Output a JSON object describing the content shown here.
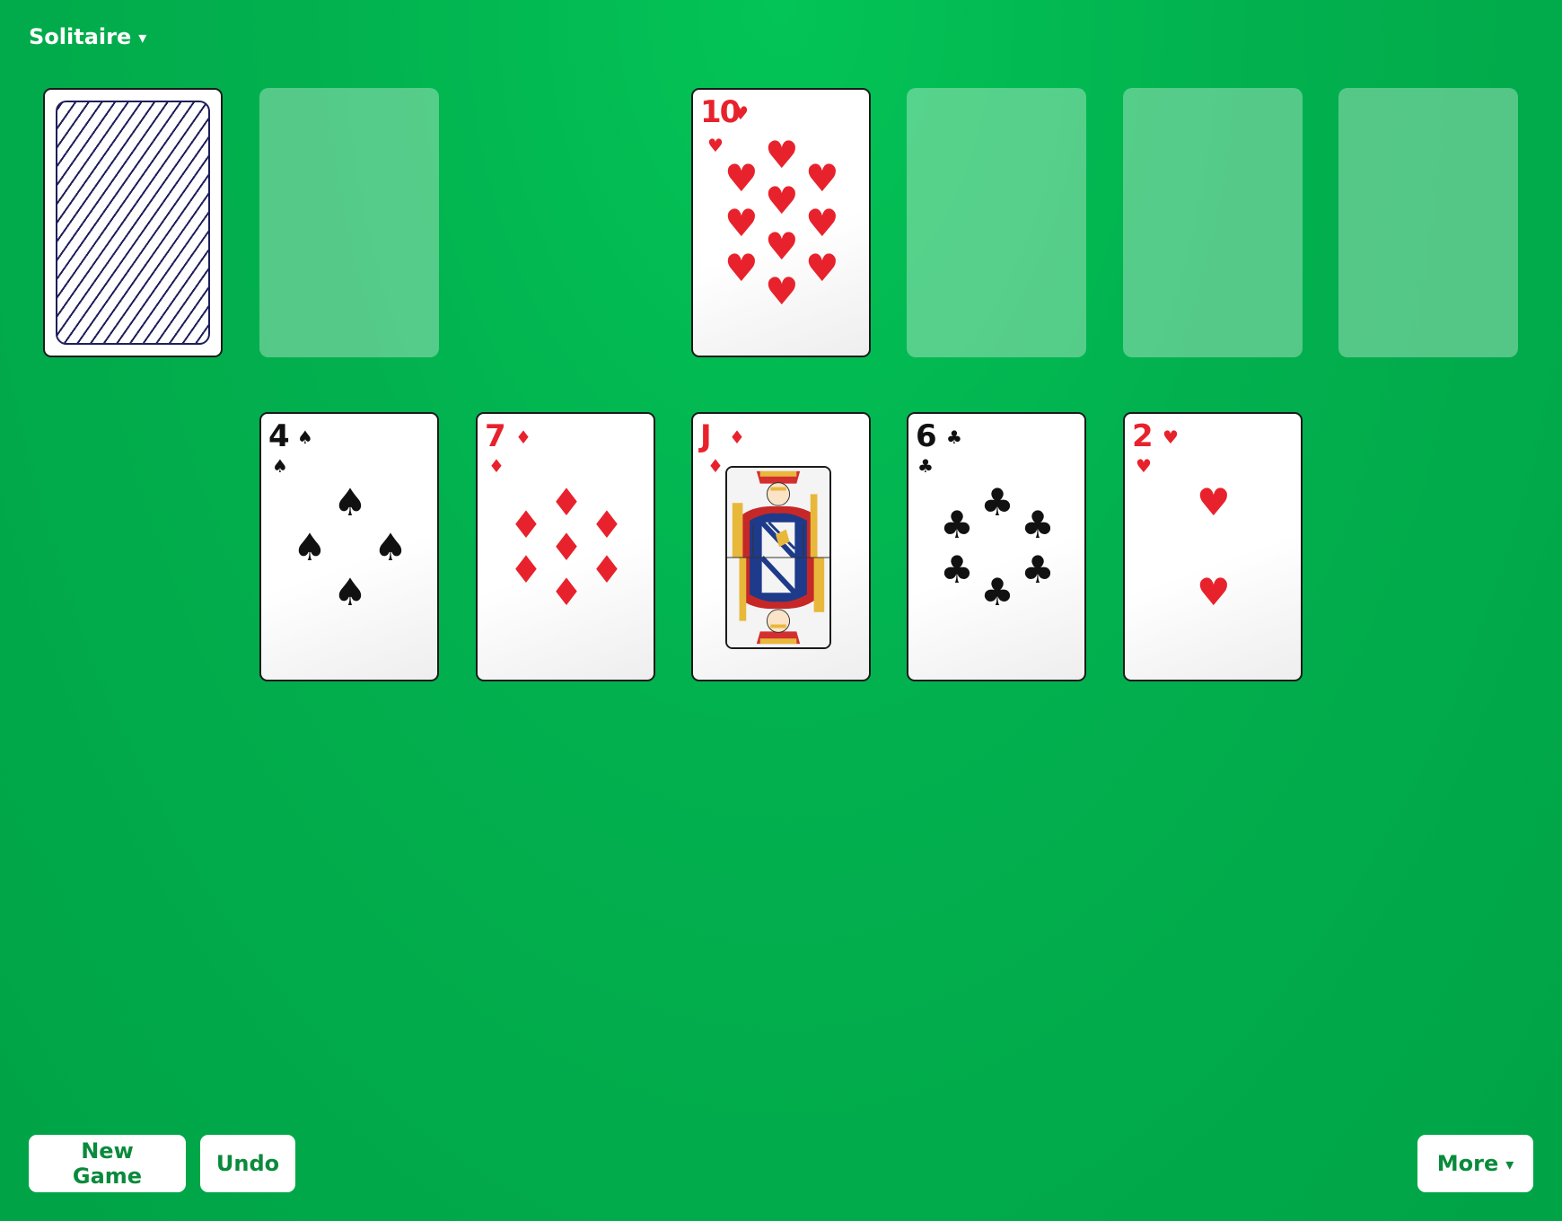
{
  "header": {
    "title": "Solitaire",
    "caret": "▾"
  },
  "stock": {
    "face_down": true
  },
  "foundation_top": {
    "rank": "10",
    "suit": "♥",
    "color": "red"
  },
  "tableau": [
    {
      "rank": "4",
      "suit": "♠",
      "color": "black"
    },
    {
      "rank": "7",
      "suit": "♦",
      "color": "red"
    },
    {
      "rank": "J",
      "suit": "♦",
      "color": "red"
    },
    {
      "rank": "6",
      "suit": "♣",
      "color": "black"
    },
    {
      "rank": "2",
      "suit": "♥",
      "color": "red"
    }
  ],
  "toolbar": {
    "new_game_label": "New Game",
    "undo_label": "Undo",
    "more_label": "More",
    "more_caret": "▾"
  },
  "colors": {
    "felt": "#00a346",
    "felt_highlight": "#03c456",
    "card_red": "#e8222c",
    "card_black": "#111111",
    "button_text": "#0a8a3c",
    "card_back_lines": "#1f1f5c"
  }
}
